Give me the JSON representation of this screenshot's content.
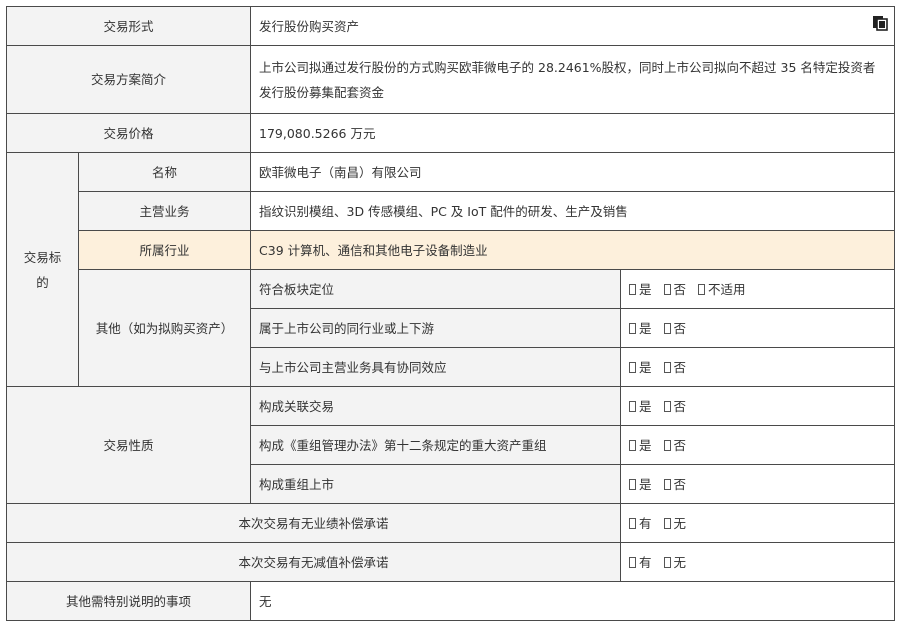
{
  "rows": {
    "form": {
      "label": "交易形式",
      "value": "发行股份购买资产"
    },
    "plan": {
      "label": "交易方案简介",
      "value": "上市公司拟通过发行股份的方式购买欧菲微电子的 28.2461%股权，同时上市公司拟向不超过 35 名特定投资者发行股份募集配套资金"
    },
    "price": {
      "label": "交易价格",
      "value": "179,080.5266 万元"
    },
    "target": {
      "group_label": "交易标的",
      "name": {
        "label": "名称",
        "value": "欧菲微电子（南昌）有限公司"
      },
      "business": {
        "label": "主营业务",
        "value": "指纹识别模组、3D 传感模组、PC 及 IoT 配件的研发、生产及销售"
      },
      "industry": {
        "label": "所属行业",
        "value": "C39 计算机、通信和其他电子设备制造业"
      },
      "other": {
        "label": "其他（如为拟购买资产）",
        "items": [
          {
            "q": "符合板块定位",
            "options": [
              "是",
              "否",
              "不适用"
            ]
          },
          {
            "q": "属于上市公司的同行业或上下游",
            "options": [
              "是",
              "否"
            ]
          },
          {
            "q": "与上市公司主营业务具有协同效应",
            "options": [
              "是",
              "否"
            ]
          }
        ]
      }
    },
    "nature": {
      "label": "交易性质",
      "items": [
        {
          "q": "构成关联交易",
          "options": [
            "是",
            "否"
          ]
        },
        {
          "q": "构成《重组管理办法》第十二条规定的重大资产重组",
          "options": [
            "是",
            "否"
          ]
        },
        {
          "q": "构成重组上市",
          "options": [
            "是",
            "否"
          ]
        }
      ]
    },
    "perf": {
      "label": "本次交易有无业绩补偿承诺",
      "options": [
        "有",
        "无"
      ]
    },
    "impair": {
      "label": "本次交易有无减值补偿承诺",
      "options": [
        "有",
        "无"
      ]
    },
    "notes": {
      "label": "其他需特别说明的事项",
      "value": "无"
    }
  }
}
